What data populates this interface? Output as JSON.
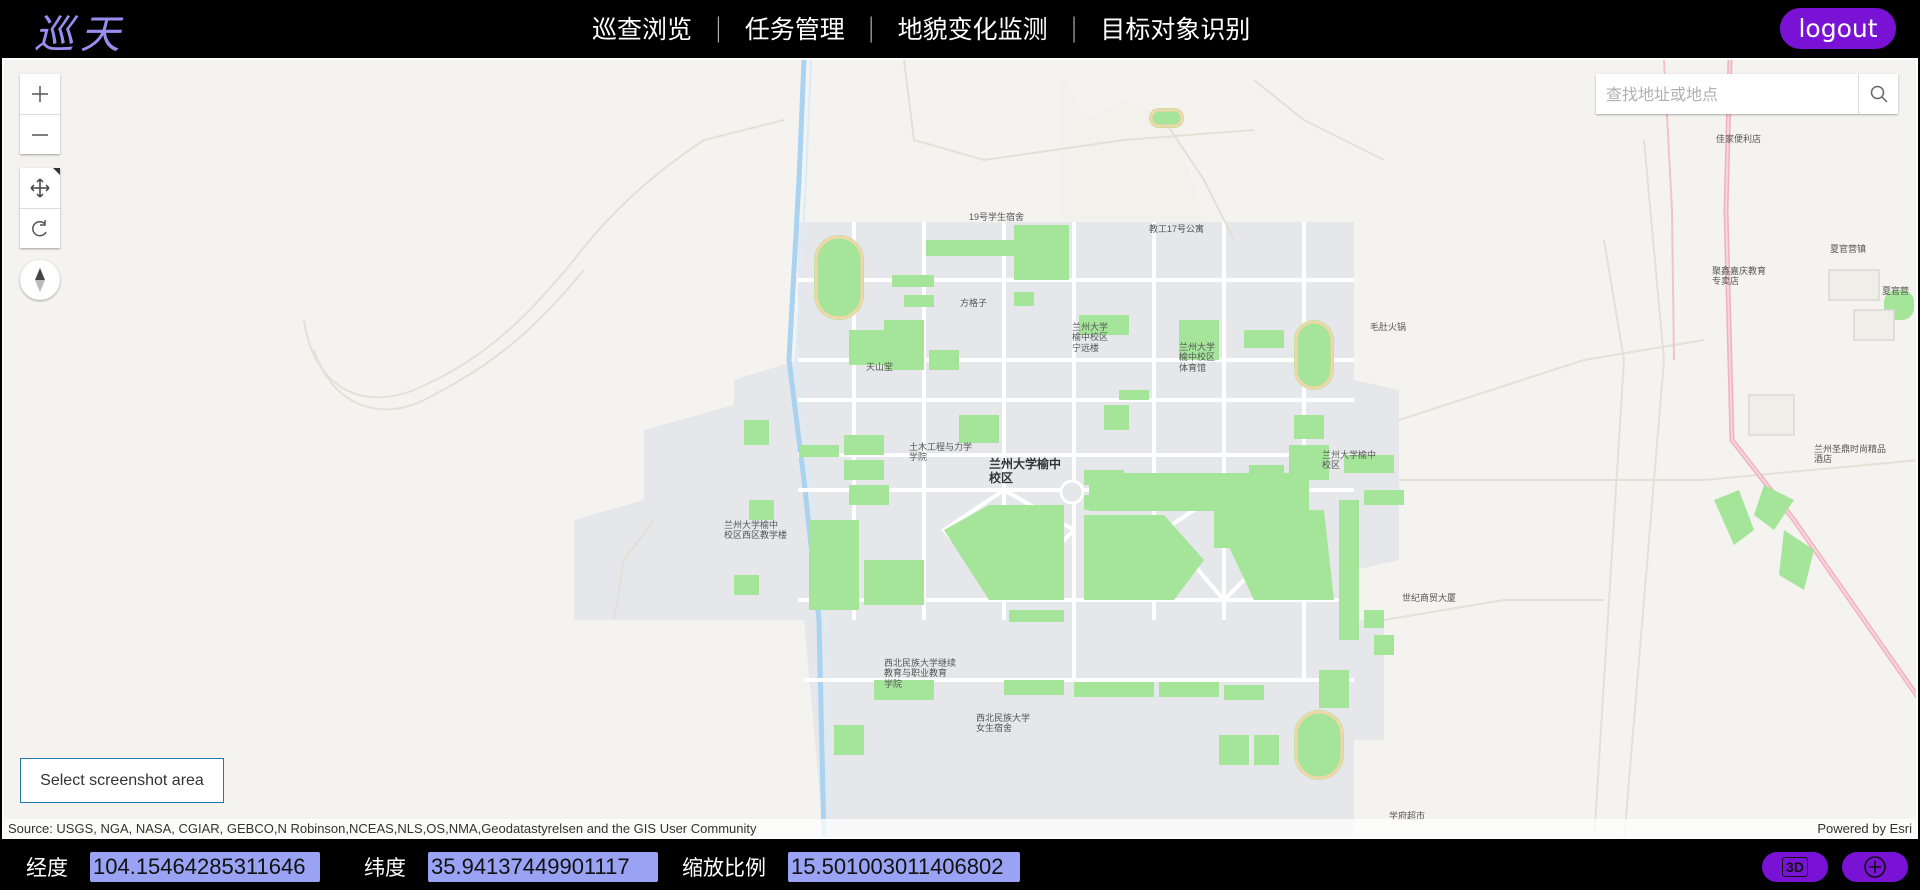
{
  "header": {
    "logo": "巡天",
    "nav": [
      "巡查浏览",
      "任务管理",
      "地貌变化监测",
      "目标对象识别"
    ],
    "logout_label": "logout",
    "accent": "#7a12d6"
  },
  "map": {
    "search": {
      "placeholder": "查找地址或地点"
    },
    "screenshot_label": "Select screenshot area",
    "attribution": {
      "source": "Source: USGS, NGA, NASA, CGIAR, GEBCO,N Robinson,NCEAS,NLS,OS,NMA,Geodatastyrelsen and the GIS User Community",
      "powered": "Powered by Esri"
    },
    "labels": [
      "19号学生宿舍",
      "教工17号公寓",
      "兰州大学\n榆中校区\n宁远楼",
      "兰州大学\n榆中校区\n体育馆",
      "毛肚火锅",
      "方格子",
      "天山堂",
      "土木工程与力学\n学院",
      "兰州大学榆中\n校区",
      "兰州大学榆中\n校区",
      "兰州大学榆中\n校区西区教学楼",
      "世纪商贸大厦",
      "西北民族大学继续\n教育与职业教育\n学院",
      "西北民族大学\n女生宿舍",
      "学府超市",
      "佳家便利店",
      "聚鑫嘉庆教育\n专卖店",
      "兰州圣鼎时尚精品\n酒店",
      "夏官营镇",
      "夏官营"
    ]
  },
  "footer": {
    "lon_label": "经度",
    "lon_value": "104.15464285311646",
    "lat_label": "纬度",
    "lat_value": "35.94137449901117",
    "scale_label": "缩放比例",
    "scale_value": "15.501003011406802",
    "btn_3d": "3D"
  }
}
